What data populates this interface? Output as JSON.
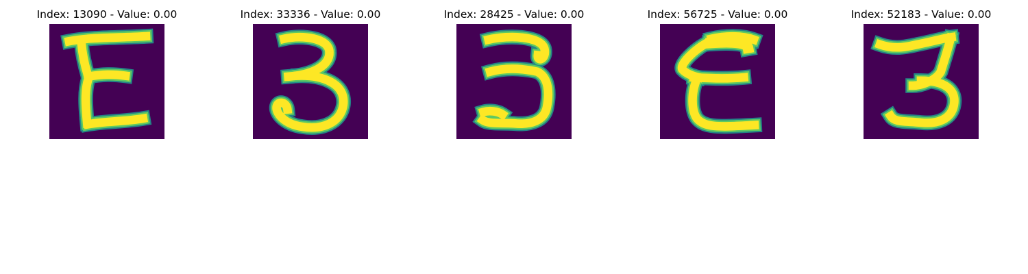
{
  "figure": {
    "colormap": "viridis",
    "background_color": "#440154",
    "stroke_color": "#fde725",
    "edge_colors": [
      "#5ec962",
      "#21918c"
    ]
  },
  "chart_data": [
    {
      "type": "heatmap",
      "title": "Index: 13090 - Value: 0.00",
      "glyph": "E-shaped handwritten digit"
    },
    {
      "type": "heatmap",
      "title": "Index: 33336 - Value: 0.00",
      "glyph": "handwritten 3"
    },
    {
      "type": "heatmap",
      "title": "Index: 28425 - Value: 0.00",
      "glyph": "handwritten 3"
    },
    {
      "type": "heatmap",
      "title": "Index: 56725 - Value: 0.00",
      "glyph": "E-shaped handwritten digit"
    },
    {
      "type": "heatmap",
      "title": "Index: 52183 - Value: 0.00",
      "glyph": "handwritten 3"
    }
  ]
}
